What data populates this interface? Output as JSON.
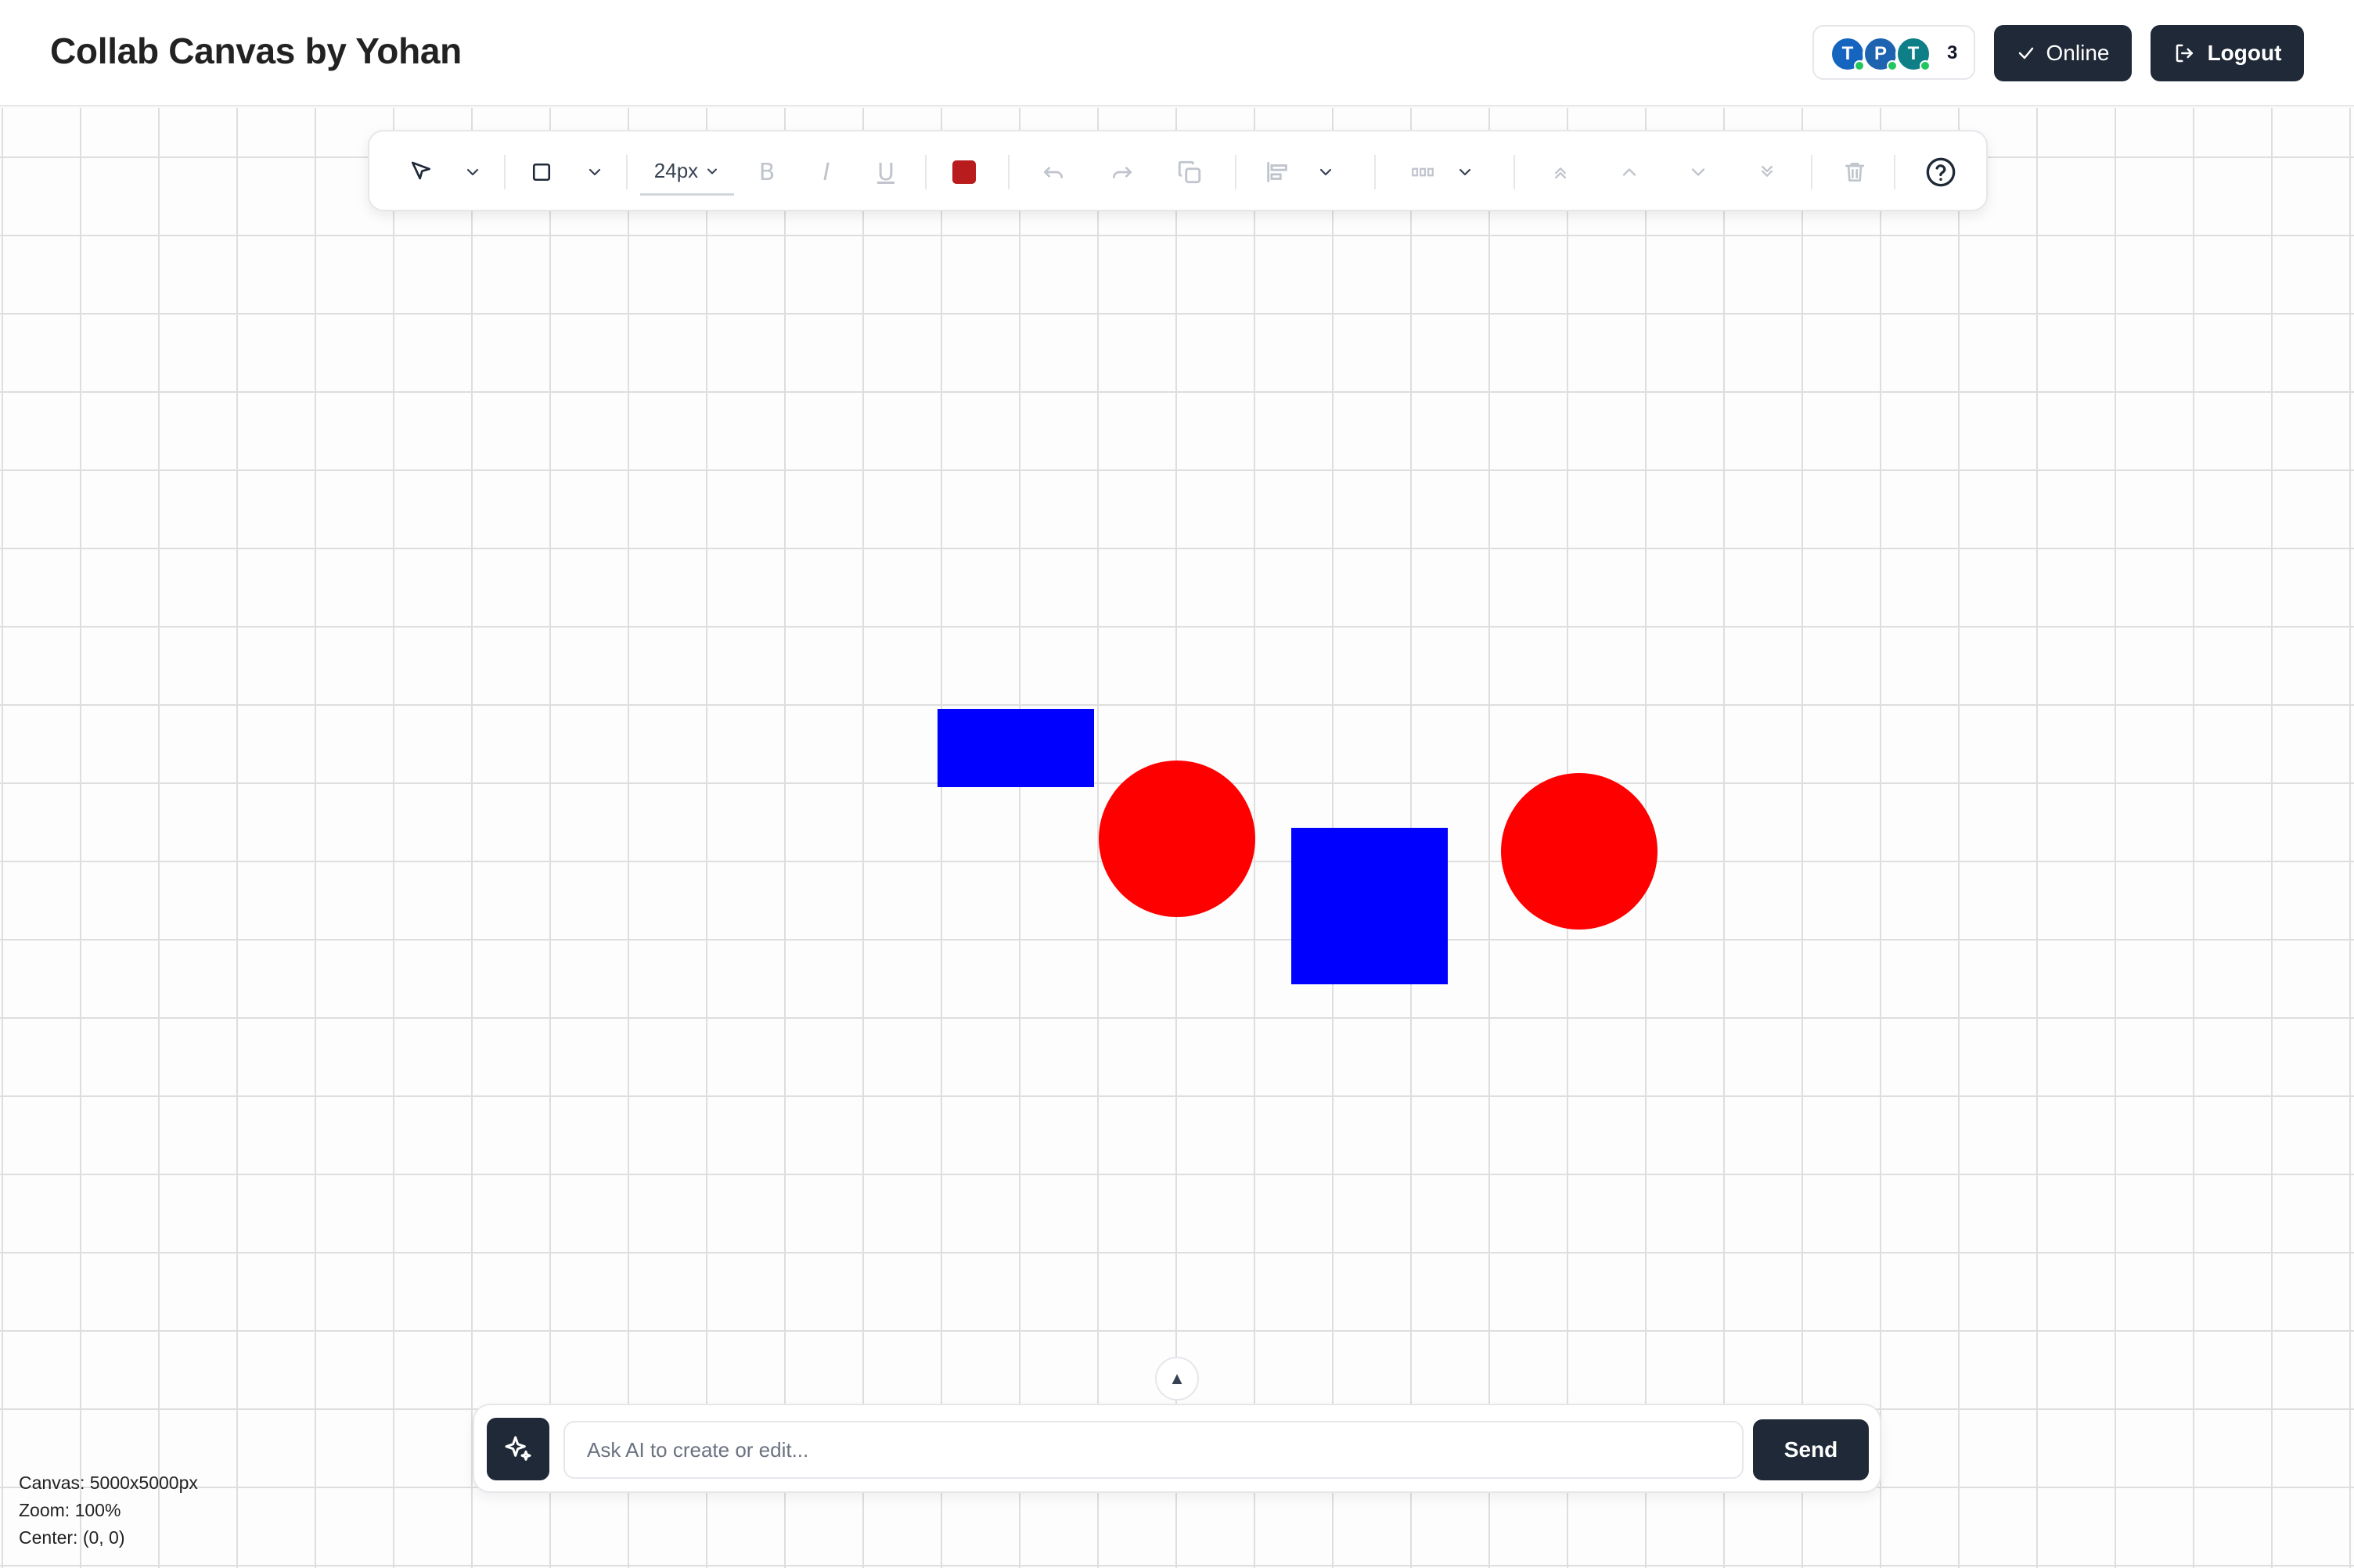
{
  "app": {
    "title": "Collab Canvas by Yohan"
  },
  "presence": {
    "users": [
      {
        "initial": "T",
        "color": "#1565c0"
      },
      {
        "initial": "P",
        "color": "#1e63b0"
      },
      {
        "initial": "T",
        "color": "#0e7f86"
      }
    ],
    "count": "3"
  },
  "header": {
    "online_label": "Online",
    "logout_label": "Logout"
  },
  "toolbar": {
    "font_size": "24px",
    "bold_label": "B",
    "italic_label": "I",
    "underline_label": "U",
    "fill_color": "#b91c1c",
    "items": [
      "select-tool",
      "rectangle-tool",
      "font-size",
      "bold",
      "italic",
      "underline",
      "color",
      "undo",
      "redo",
      "duplicate",
      "align",
      "distribute",
      "bring-to-front",
      "bring-forward",
      "send-backward",
      "send-to-back",
      "delete",
      "help"
    ]
  },
  "canvas": {
    "shapes": [
      {
        "type": "rectangle",
        "fill": "#0000ff"
      },
      {
        "type": "circle",
        "fill": "#ff0000"
      },
      {
        "type": "rectangle",
        "fill": "#0000ff"
      },
      {
        "type": "circle",
        "fill": "#ff0000"
      }
    ]
  },
  "ai": {
    "placeholder": "Ask AI to create or edit...",
    "send_label": "Send",
    "collapse_glyph": "▲"
  },
  "info": {
    "canvas_size": "Canvas: 5000x5000px",
    "zoom": "Zoom: 100%",
    "center": "Center: (0, 0)"
  }
}
